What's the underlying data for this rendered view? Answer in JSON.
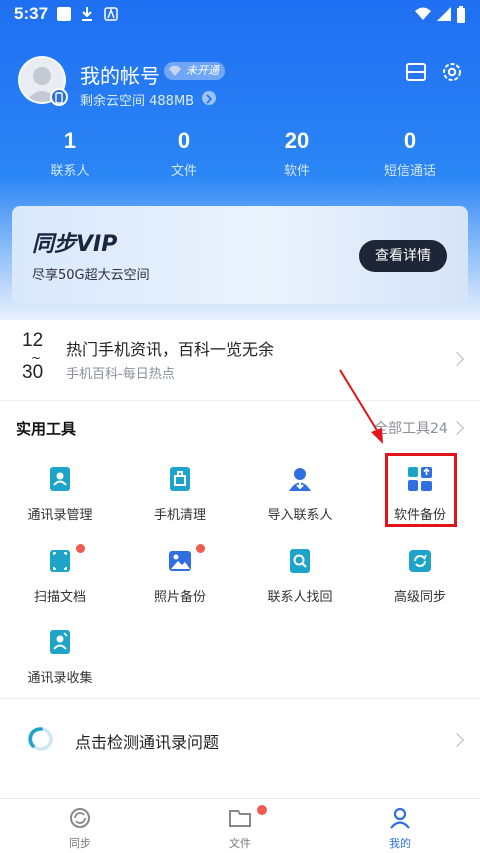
{
  "status_bar": {
    "time": "5:37"
  },
  "profile": {
    "account_name": "我的帐号",
    "vip_status": "未开通",
    "cloud_space": "剩余云空间 488MB"
  },
  "stats": [
    {
      "value": "1",
      "label": "联系人"
    },
    {
      "value": "0",
      "label": "文件"
    },
    {
      "value": "20",
      "label": "软件"
    },
    {
      "value": "0",
      "label": "短信通话"
    }
  ],
  "vip_card": {
    "title": "同步VIP",
    "subtitle": "尽享50G超大云空间",
    "button": "查看详情"
  },
  "news": {
    "date_top": "12",
    "date_sep": "~",
    "date_bottom": "30",
    "title": "热门手机资讯，百科一览无余",
    "subtitle": "手机百科-每日热点"
  },
  "tools": {
    "heading": "实用工具",
    "all_link": "全部工具24",
    "items": [
      {
        "label": "通讯录管理",
        "icon": "contacts-book-icon"
      },
      {
        "label": "手机清理",
        "icon": "phone-clean-icon"
      },
      {
        "label": "导入联系人",
        "icon": "import-contact-icon"
      },
      {
        "label": "软件备份",
        "icon": "app-backup-icon"
      },
      {
        "label": "扫描文档",
        "icon": "scan-document-icon"
      },
      {
        "label": "照片备份",
        "icon": "photo-backup-icon"
      },
      {
        "label": "联系人找回",
        "icon": "contact-recover-icon"
      },
      {
        "label": "高级同步",
        "icon": "advanced-sync-icon"
      },
      {
        "label": "通讯录收集",
        "icon": "contacts-collect-icon"
      }
    ]
  },
  "detect": {
    "text": "点击检测通讯录问题"
  },
  "bottom_nav": [
    {
      "label": "同步",
      "icon": "sync-icon"
    },
    {
      "label": "文件",
      "icon": "folder-icon"
    },
    {
      "label": "我的",
      "icon": "profile-icon"
    }
  ],
  "colors": {
    "accent": "#2f6fe0",
    "highlight": "#e0141a",
    "badge": "#f05a4f"
  }
}
